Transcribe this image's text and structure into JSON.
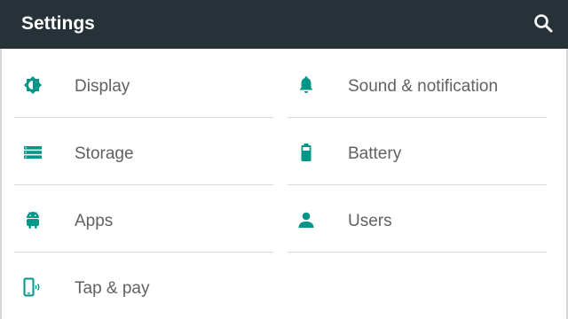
{
  "header": {
    "title": "Settings",
    "search_icon": "search-icon"
  },
  "colors": {
    "toolbar": "#263238",
    "accent": "#009688",
    "label": "#616161",
    "divider": "#dcdcdc"
  },
  "settings": {
    "display": {
      "label": "Display",
      "icon": "brightness-icon"
    },
    "storage": {
      "label": "Storage",
      "icon": "storage-icon"
    },
    "apps": {
      "label": "Apps",
      "icon": "android-icon"
    },
    "tap_pay": {
      "label": "Tap & pay",
      "icon": "tap-pay-icon"
    },
    "sound": {
      "label": "Sound & notification",
      "icon": "bell-icon"
    },
    "battery": {
      "label": "Battery",
      "icon": "battery-icon"
    },
    "users": {
      "label": "Users",
      "icon": "person-icon"
    }
  }
}
